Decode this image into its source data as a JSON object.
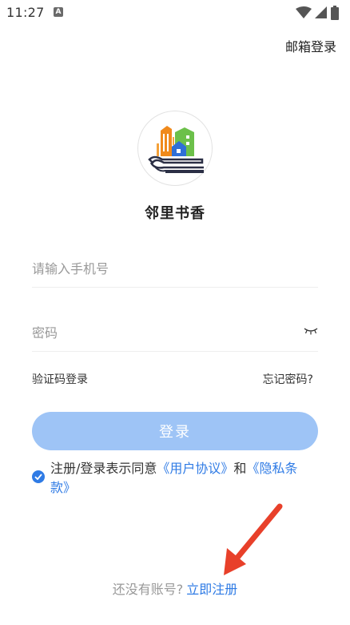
{
  "status_bar": {
    "time": "11:27",
    "icons": [
      "a-indicator-icon",
      "wifi-icon",
      "signal-icon",
      "battery-icon"
    ]
  },
  "header": {
    "email_login": "邮箱登录"
  },
  "app": {
    "name": "邻里书香",
    "logo_icon": "book-houses-logo"
  },
  "form": {
    "phone_placeholder": "请输入手机号",
    "phone_value": "",
    "password_placeholder": "密码",
    "password_value": "",
    "password_toggle_icon": "eye-closed-icon",
    "sms_login": "验证码登录",
    "forgot_password": "忘记密码?",
    "login_button": "登录"
  },
  "agreement": {
    "checked": true,
    "prefix": "注册/登录表示同意",
    "user_agreement": "《用户协议》",
    "conjunction": "和",
    "privacy_policy_part1": "《隐私条",
    "privacy_policy_part2": "款》"
  },
  "footer": {
    "no_account": "还没有账号?",
    "register_now": "立即注册"
  },
  "colors": {
    "accent": "#2f7be5",
    "button_bg": "#9ec4f6",
    "annotation_arrow": "#e8402a"
  }
}
